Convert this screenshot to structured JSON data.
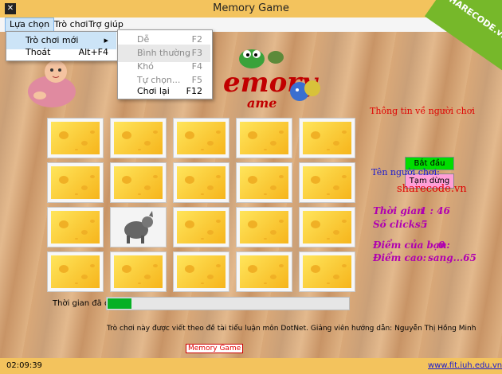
{
  "window": {
    "title": "Memory Game",
    "app_icon": "game-icon"
  },
  "brand": {
    "watermark": "SHARECODE.vn"
  },
  "menubar": {
    "items": [
      "Lựa chọn",
      "Trò chơi",
      "Trợ giúp"
    ]
  },
  "menu_lua_chon": {
    "items": [
      {
        "label": "Trò chơi mới",
        "shortcut": "",
        "submenu_arrow": "▸"
      },
      {
        "label": "Thoát",
        "shortcut": "Alt+F4"
      }
    ]
  },
  "submenu_tro_choi_moi": {
    "items": [
      {
        "label": "Dễ",
        "shortcut": "F2"
      },
      {
        "label": "Bình thường",
        "shortcut": "F3"
      },
      {
        "label": "Khó",
        "shortcut": "F4"
      },
      {
        "label": "Tự chọn...",
        "shortcut": "F5"
      },
      {
        "label": "Chơi lại",
        "shortcut": "F12"
      }
    ]
  },
  "logo": {
    "title": "emory",
    "subtitle": "ame"
  },
  "board": {
    "rows": 4,
    "cols": 5,
    "revealed": [
      {
        "row": 2,
        "col": 1,
        "icon": "donkey-icon"
      }
    ]
  },
  "side": {
    "info_title": "Thông tin về người chơi",
    "start_label": "Bắt đầu",
    "pause_label": "Tạm dừng",
    "player_label": "Tên người chơi:",
    "player_name": "sharecode.vn",
    "time_label": "Thời gian",
    "time_value": "1 : 46",
    "clicks_label": "Số clicks :",
    "clicks_value": "5",
    "score_label": "Điểm của bạn:",
    "score_value": "0",
    "high_label": "Điểm cao:",
    "high_value": "sang...65"
  },
  "footer": {
    "elapsed_label": "Thời gian đã qua",
    "progress": 0.1,
    "credit": "Trò chơi này được viết theo đề tài tiểu luận môn DotNet. Giảng viên hướng dẫn: Nguyễn Thị Hồng Minh",
    "badge": "Memory Game"
  },
  "status": {
    "clock": "02:09:39",
    "link": "www.fit.iuh.edu.vn"
  },
  "colors": {
    "title_bar": "#f3c35d",
    "progress": "#06b025",
    "accent_red": "#e00000",
    "accent_purple": "#b000b0"
  }
}
